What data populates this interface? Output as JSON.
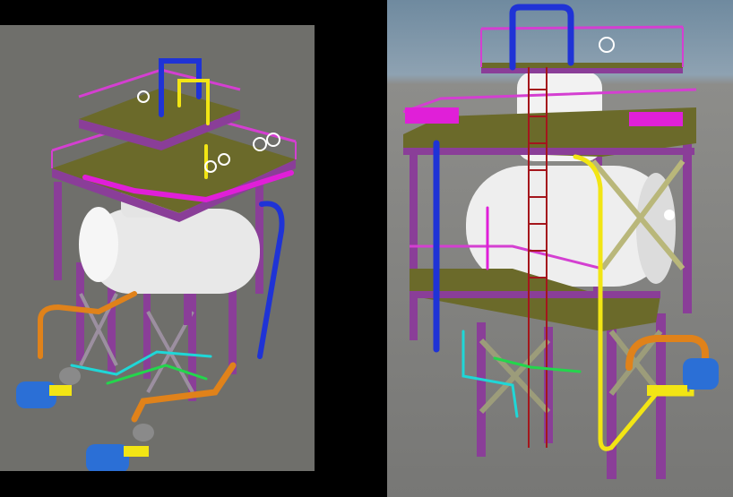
{
  "views": [
    {
      "id": "isometric-view",
      "description_visible": false
    },
    {
      "id": "side-view",
      "description_visible": false
    }
  ],
  "colors": {
    "background_left": "#6f6f6b",
    "sky_right": "#7f97a9",
    "ground_right": "#7c7c79",
    "steel_structure": "#8a3e98",
    "platform_deck": "#6b6a2a",
    "handrail": "#d43fd1",
    "vessel": "#eeeeee",
    "pipe_blue": "#1f33d6",
    "pipe_yellow": "#f2e514",
    "pipe_magenta": "#e01fd8",
    "pipe_orange": "#e0821a",
    "pipe_cyan": "#1fd7d7",
    "pipe_green": "#23d64c",
    "pump_motor": "#2b6fd6",
    "ladder_red": "#a4161c"
  }
}
